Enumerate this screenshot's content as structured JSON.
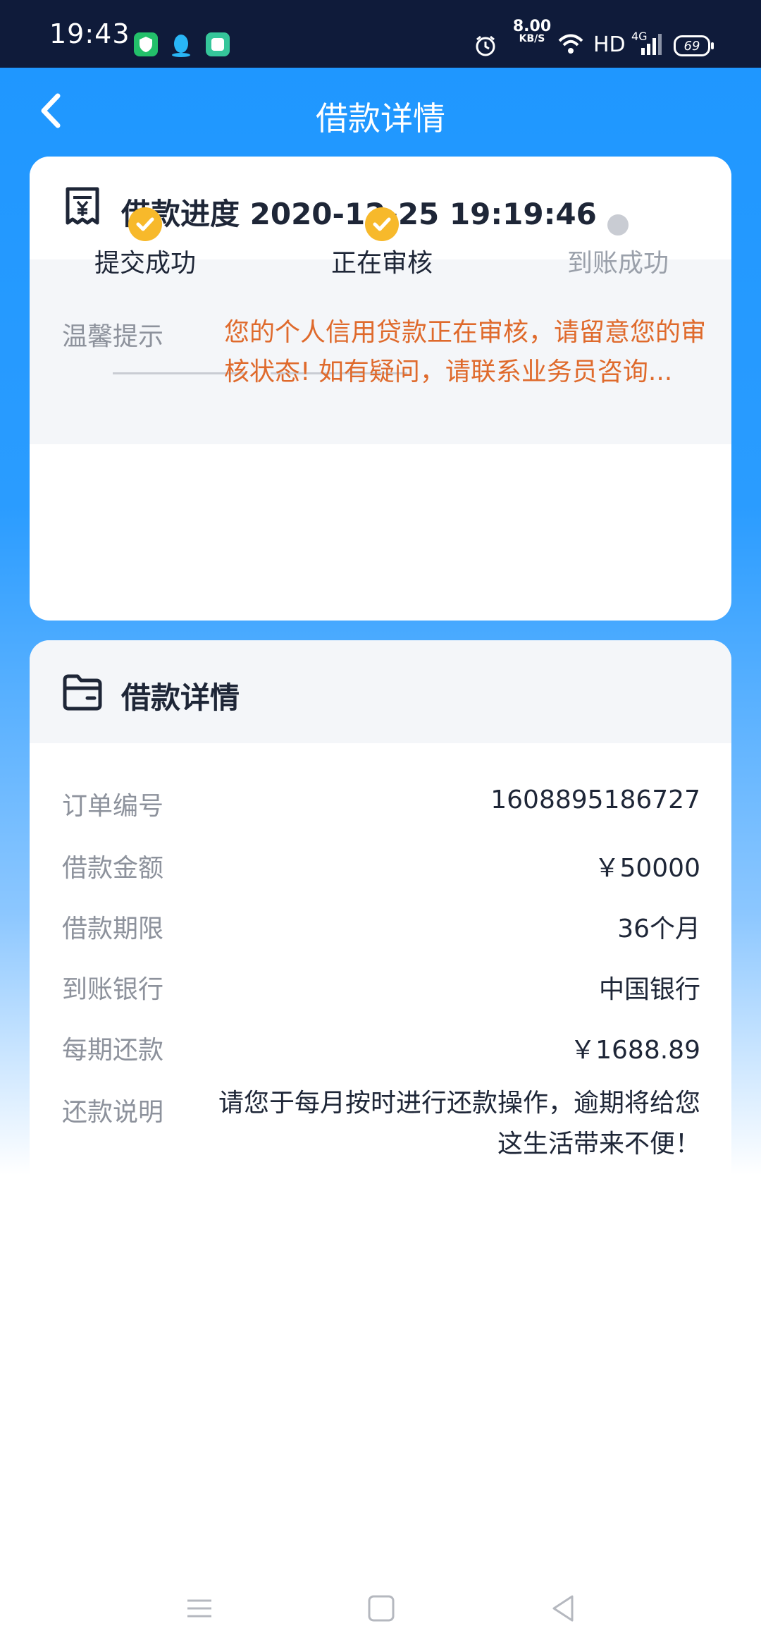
{
  "status_bar": {
    "time": "19:43",
    "net_speed_value": "8.00",
    "net_speed_unit": "KB/S",
    "hd": "HD",
    "network": "4G",
    "battery": "69"
  },
  "header": {
    "title": "借款详情",
    "back_icon": "chevron-left-icon"
  },
  "progress_card": {
    "icon": "receipt-yuan-icon",
    "heading": "借款进度 2020-12-25 19:19:46",
    "steps": [
      {
        "label": "提交成功",
        "state": "done"
      },
      {
        "label": "正在审核",
        "state": "done"
      },
      {
        "label": "到账成功",
        "state": "pending"
      }
    ],
    "tip_label": "温馨提示",
    "tip_text": "您的个人信用贷款正在审核，请留意您的审核状态! 如有疑问，请联系业务员咨询..."
  },
  "detail_card": {
    "icon": "folder-icon",
    "heading": "借款详情",
    "rows": [
      {
        "label": "订单编号",
        "value": "1608895186727"
      },
      {
        "label": "借款金额",
        "value": "￥50000"
      },
      {
        "label": "借款期限",
        "value": "36个月"
      },
      {
        "label": "到账银行",
        "value": "中国银行"
      },
      {
        "label": "每期还款",
        "value": "￥1688.89"
      },
      {
        "label": "还款说明",
        "value": "请您于每月按时进行还款操作，逾期将给您这生活带来不便！"
      }
    ]
  },
  "colors": {
    "status_bar_bg": "#0f1b3a",
    "header_blue": "#1f97ff",
    "step_done": "#f7b92b",
    "step_pending": "#c9ccd3",
    "tip_orange": "#df6a2c"
  }
}
